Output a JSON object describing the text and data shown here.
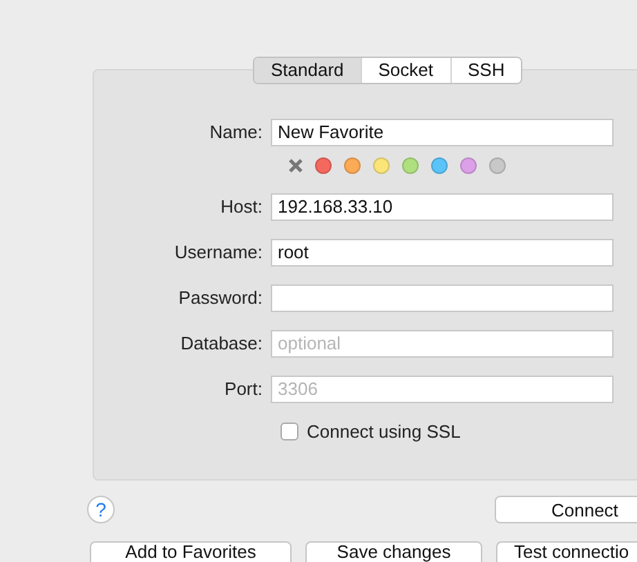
{
  "tabs": [
    {
      "label": "Standard",
      "selected": true
    },
    {
      "label": "Socket",
      "selected": false
    },
    {
      "label": "SSH",
      "selected": false
    }
  ],
  "fields": [
    {
      "kind": "text",
      "label": "Name:",
      "value": "New Favorite"
    },
    {
      "kind": "colors",
      "colors": [
        {
          "color": "#f4685e"
        },
        {
          "color": "#fbaa55"
        },
        {
          "color": "#fbe478"
        },
        {
          "color": "#aee07e"
        },
        {
          "color": "#5ac4f8"
        },
        {
          "color": "#dba0e8"
        },
        {
          "color": "#c8c8c8"
        }
      ]
    },
    {
      "kind": "text",
      "label": "Host:",
      "value": "192.168.33.10"
    },
    {
      "kind": "text",
      "label": "Username:",
      "value": "root"
    },
    {
      "kind": "text",
      "label": "Password:"
    },
    {
      "kind": "text",
      "label": "Database:",
      "placeholder": "optional"
    },
    {
      "kind": "text",
      "label": "Port:",
      "placeholder": "3306"
    },
    {
      "kind": "check",
      "label": "Connect using SSL",
      "checked": false
    }
  ],
  "help": "?",
  "connect": "Connect",
  "buttons": [
    "Add to Favorites",
    "Save changes",
    "Test connectio"
  ]
}
